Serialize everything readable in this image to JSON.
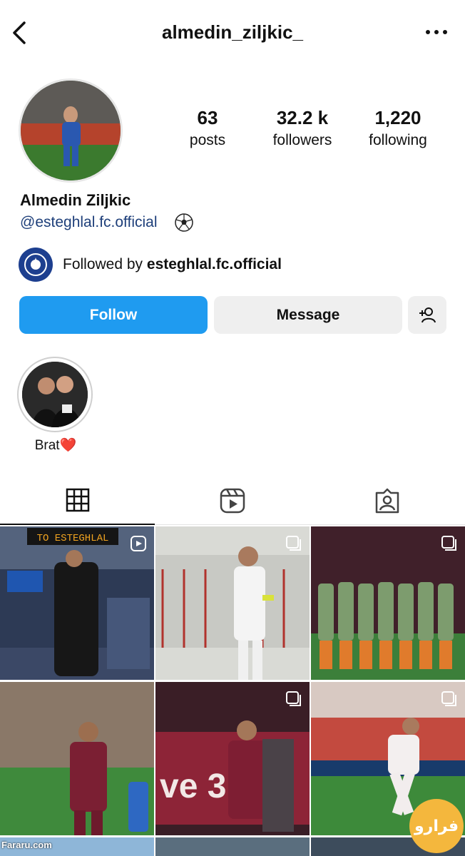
{
  "header": {
    "username": "almedin_ziljkic_",
    "back_icon": "chevron-left-icon",
    "more_icon": "more-horizontal-icon"
  },
  "profile": {
    "stats": [
      {
        "value": "63",
        "label": "posts"
      },
      {
        "value": "32.2 k",
        "label": "followers"
      },
      {
        "value": "1,220",
        "label": "following"
      }
    ],
    "full_name": "Almedin Ziljkic",
    "bio_link": "@esteghlal.fc.official",
    "bio_emoji": "soccer-ball-icon",
    "followed_by_prefix": "Followed by ",
    "followed_by_account": "esteghlal.fc.official"
  },
  "actions": {
    "follow": "Follow",
    "message": "Message",
    "add_user_icon": "add-user-icon"
  },
  "highlights": [
    {
      "label": "Brat❤️"
    }
  ],
  "tabs": [
    {
      "name": "grid-icon",
      "active": true
    },
    {
      "name": "reels-icon",
      "active": false
    },
    {
      "name": "tagged-icon",
      "active": false
    }
  ],
  "posts": [
    {
      "overlay_text": "TO ESTEGHLAL",
      "badge": "reel-icon"
    },
    {
      "overlay_text": "",
      "badge": "carousel-icon"
    },
    {
      "overlay_text": "",
      "badge": "carousel-icon"
    },
    {
      "overlay_text": "",
      "badge": "none"
    },
    {
      "overlay_text": "",
      "badge": "carousel-icon"
    },
    {
      "overlay_text": "",
      "badge": "carousel-icon"
    }
  ],
  "watermark": {
    "site": "Fararu.com",
    "logo": "فرارو"
  },
  "colors": {
    "follow_button": "#1f9bf0",
    "secondary_button": "#efefef",
    "link": "#1e3f7a"
  }
}
